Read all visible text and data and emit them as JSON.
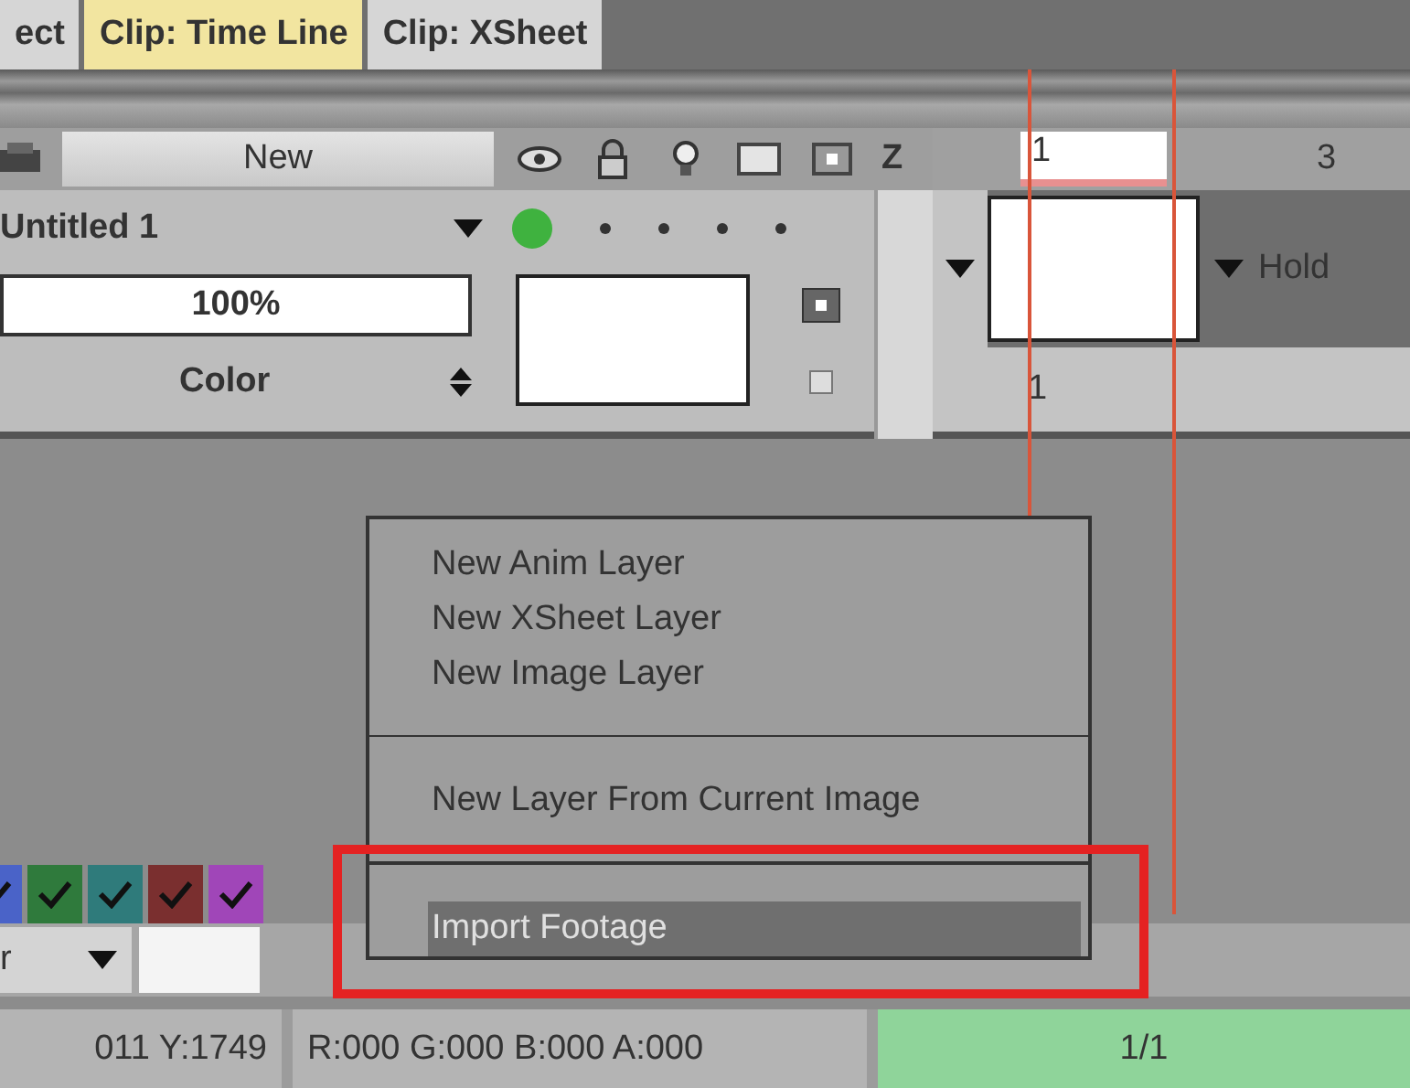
{
  "tabs": [
    {
      "label": "ect",
      "selected": false
    },
    {
      "label": "Clip: Time Line",
      "selected": true
    },
    {
      "label": "Clip: XSheet",
      "selected": false
    }
  ],
  "layer_header": {
    "new_button": "New",
    "z_label": "Z"
  },
  "layer": {
    "name": "Untitled 1",
    "active": true,
    "opacity": "100%",
    "blend_mode": "Color"
  },
  "timeline": {
    "ruler": [
      "1",
      "3"
    ],
    "hold": "Hold",
    "frame": "1"
  },
  "swatches": [
    {
      "color": "#4a63c8",
      "checked": true
    },
    {
      "color": "#2f7a3c",
      "checked": true
    },
    {
      "color": "#2f7b7b",
      "checked": true
    },
    {
      "color": "#7a2f2f",
      "checked": true
    },
    {
      "color": "#a046b8",
      "checked": true
    }
  ],
  "bottom_dropdown": {
    "value": "r"
  },
  "context_menu": [
    {
      "kind": "item",
      "label": "New Anim Layer",
      "selected": false
    },
    {
      "kind": "item",
      "label": "New XSheet Layer",
      "selected": false
    },
    {
      "kind": "item",
      "label": "New Image Layer",
      "selected": false
    },
    {
      "kind": "separator"
    },
    {
      "kind": "item",
      "label": "New Layer From Current Image",
      "selected": false
    },
    {
      "kind": "separator"
    },
    {
      "kind": "item",
      "label": "Import Footage",
      "selected": true
    }
  ],
  "status_bar": {
    "coords": "011 Y:1749",
    "rgba": "R:000 G:000 B:000 A:000",
    "frame": "1/1"
  }
}
